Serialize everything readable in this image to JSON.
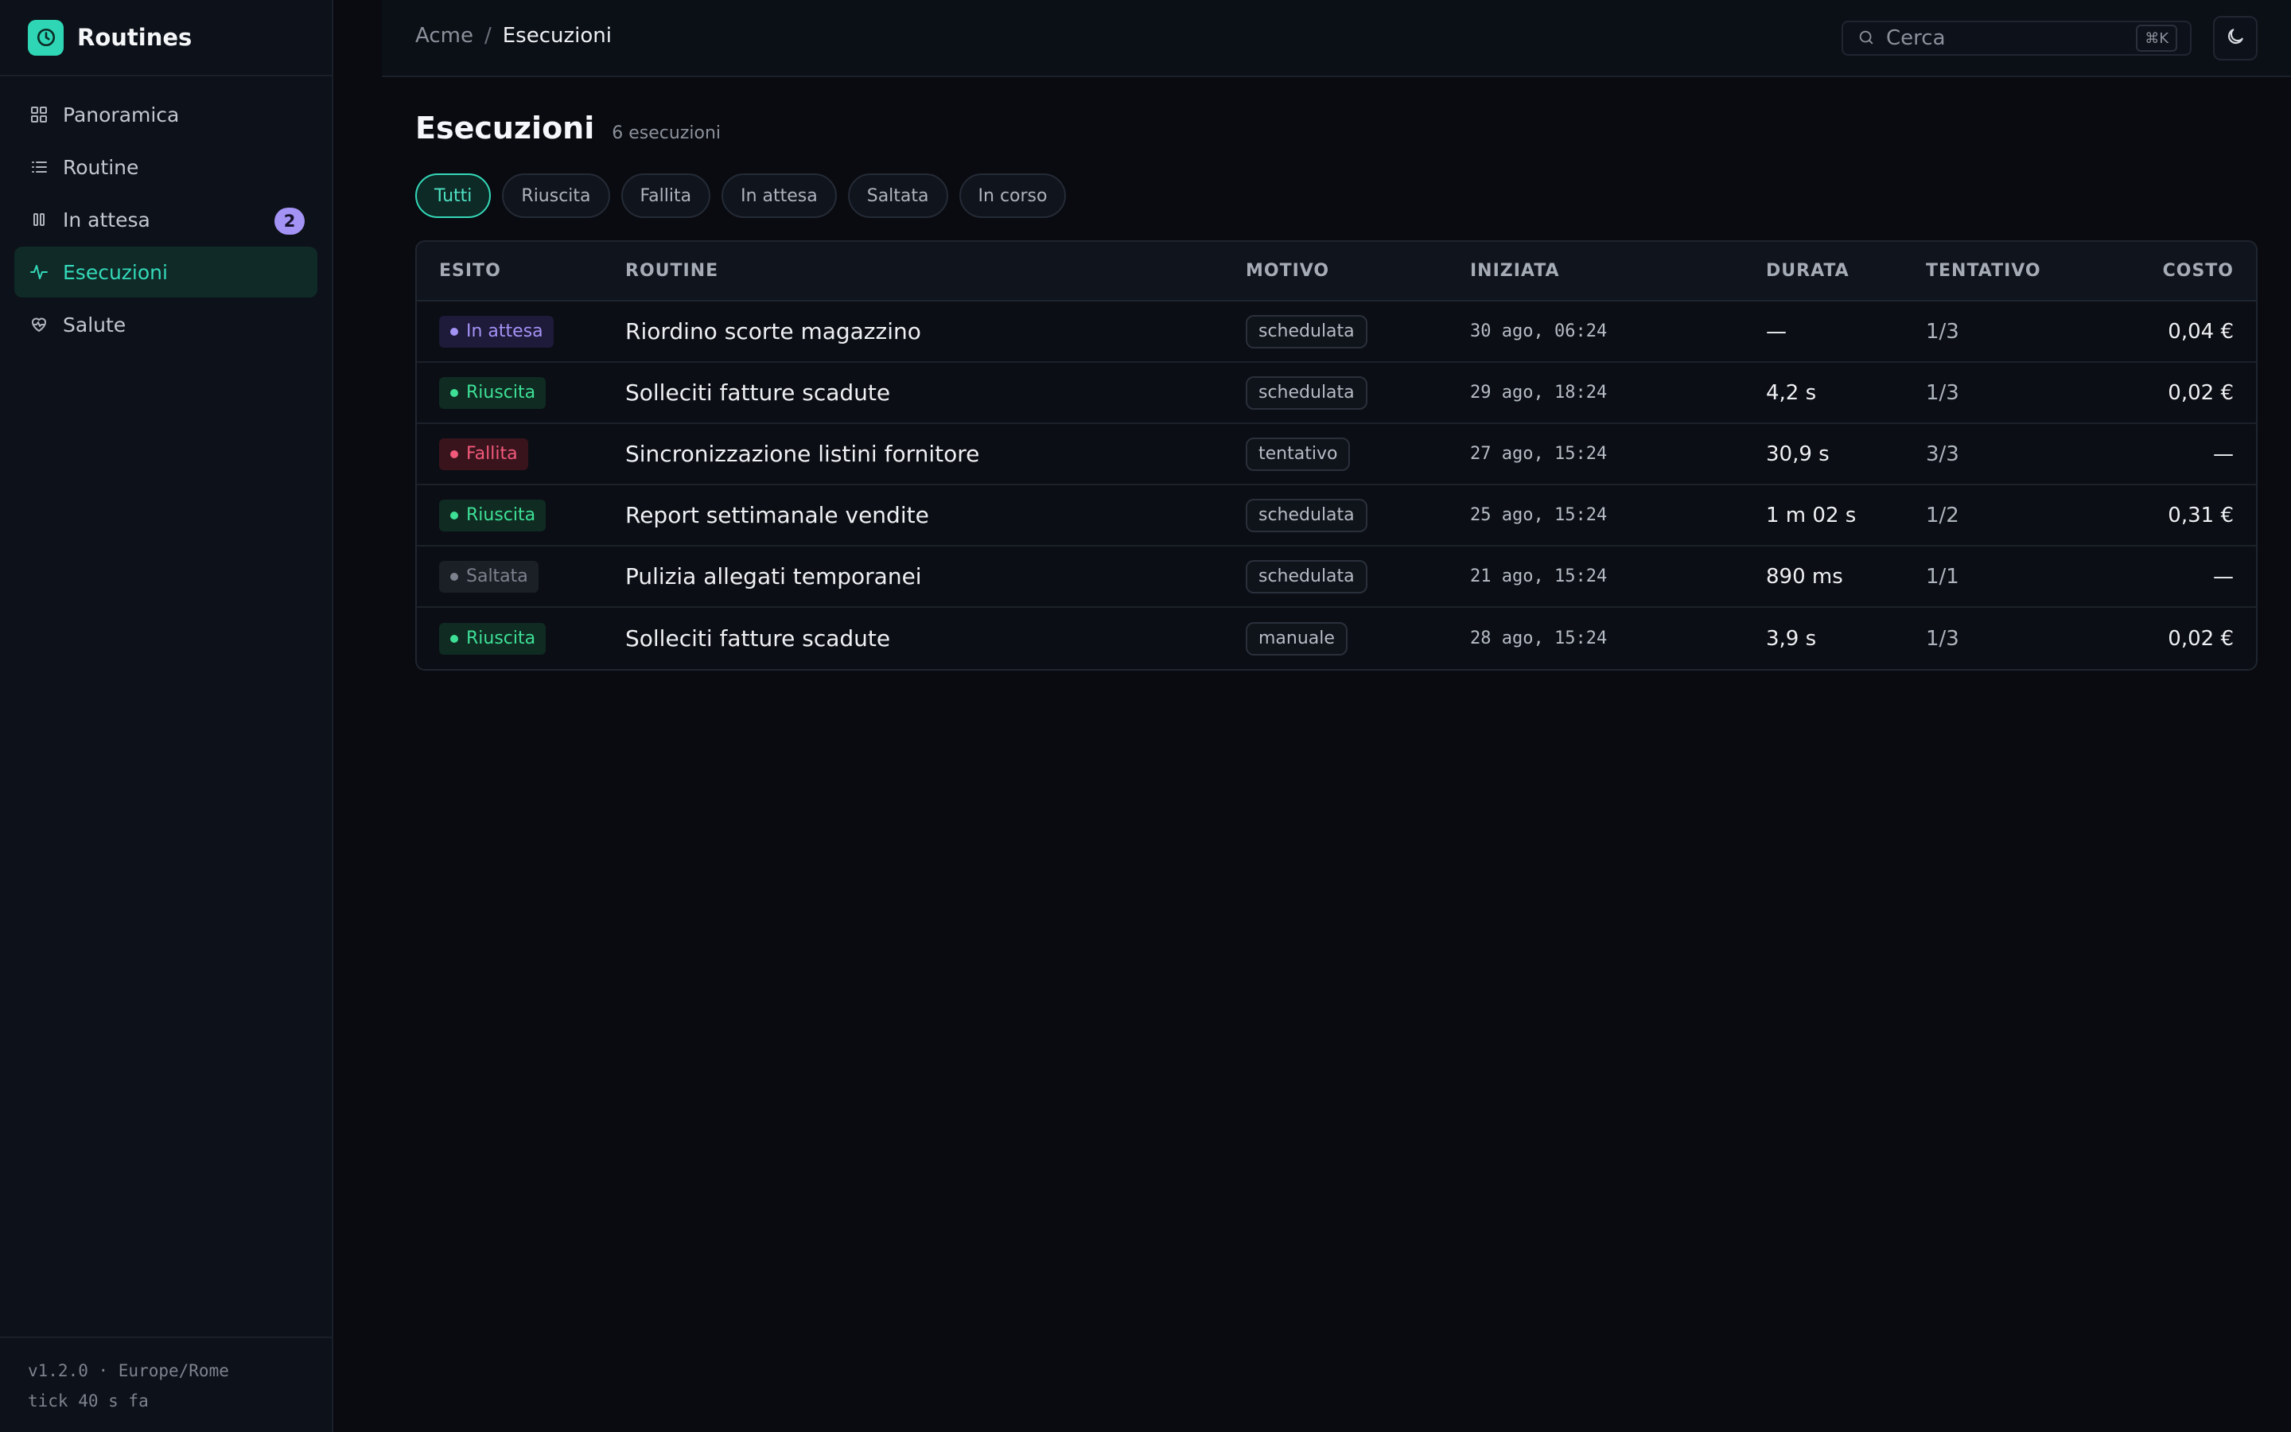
{
  "app": {
    "name": "Routines"
  },
  "sidebar": {
    "items": [
      {
        "label": "Panoramica",
        "icon": "grid-icon"
      },
      {
        "label": "Routine",
        "icon": "list-icon"
      },
      {
        "label": "In attesa",
        "icon": "pause-icon",
        "badge": "2"
      },
      {
        "label": "Esecuzioni",
        "icon": "activity-icon",
        "active": true
      },
      {
        "label": "Salute",
        "icon": "heart-pulse-icon"
      }
    ],
    "footer": {
      "line1": "v1.2.0 · Europe/Rome",
      "line2": "tick 40 s fa"
    }
  },
  "topbar": {
    "breadcrumb": {
      "root": "Acme",
      "separator": "/",
      "current": "Esecuzioni"
    },
    "search": {
      "placeholder": "Cerca",
      "shortcut": "⌘K"
    }
  },
  "page": {
    "title": "Esecuzioni",
    "count": "6 esecuzioni"
  },
  "filters": [
    "Tutti",
    "Riuscita",
    "Fallita",
    "In attesa",
    "Saltata",
    "In corso"
  ],
  "table": {
    "columns": [
      "ESITO",
      "ROUTINE",
      "MOTIVO",
      "INIZIATA",
      "DURATA",
      "TENTATIVO",
      "COSTO"
    ],
    "rows": [
      {
        "status": "In attesa",
        "routine": "Riordino scorte magazzino",
        "motivo": "schedulata",
        "iniziata": "30 ago, 06:24",
        "durata": "—",
        "tentativo": "1/3",
        "costo": "0,04 €"
      },
      {
        "status": "Riuscita",
        "routine": "Solleciti fatture scadute",
        "motivo": "schedulata",
        "iniziata": "29 ago, 18:24",
        "durata": "4,2 s",
        "tentativo": "1/3",
        "costo": "0,02 €"
      },
      {
        "status": "Fallita",
        "routine": "Sincronizzazione listini fornitore",
        "motivo": "tentativo",
        "iniziata": "27 ago, 15:24",
        "durata": "30,9 s",
        "tentativo": "3/3",
        "costo": "—"
      },
      {
        "status": "Riuscita",
        "routine": "Report settimanale vendite",
        "motivo": "schedulata",
        "iniziata": "25 ago, 15:24",
        "durata": "1 m 02 s",
        "tentativo": "1/2",
        "costo": "0,31 €"
      },
      {
        "status": "Saltata",
        "routine": "Pulizia allegati temporanei",
        "motivo": "schedulata",
        "iniziata": "21 ago, 15:24",
        "durata": "890 ms",
        "tentativo": "1/1",
        "costo": "—"
      },
      {
        "status": "Riuscita",
        "routine": "Solleciti fatture scadute",
        "motivo": "manuale",
        "iniziata": "28 ago, 15:24",
        "durata": "3,9 s",
        "tentativo": "1/3",
        "costo": "0,02 €"
      }
    ]
  },
  "colors": {
    "accent": "#34d9b9",
    "pending": "#a393f5",
    "success": "#3ee096",
    "failed": "#f2597a",
    "skipped": "#7d838e"
  }
}
